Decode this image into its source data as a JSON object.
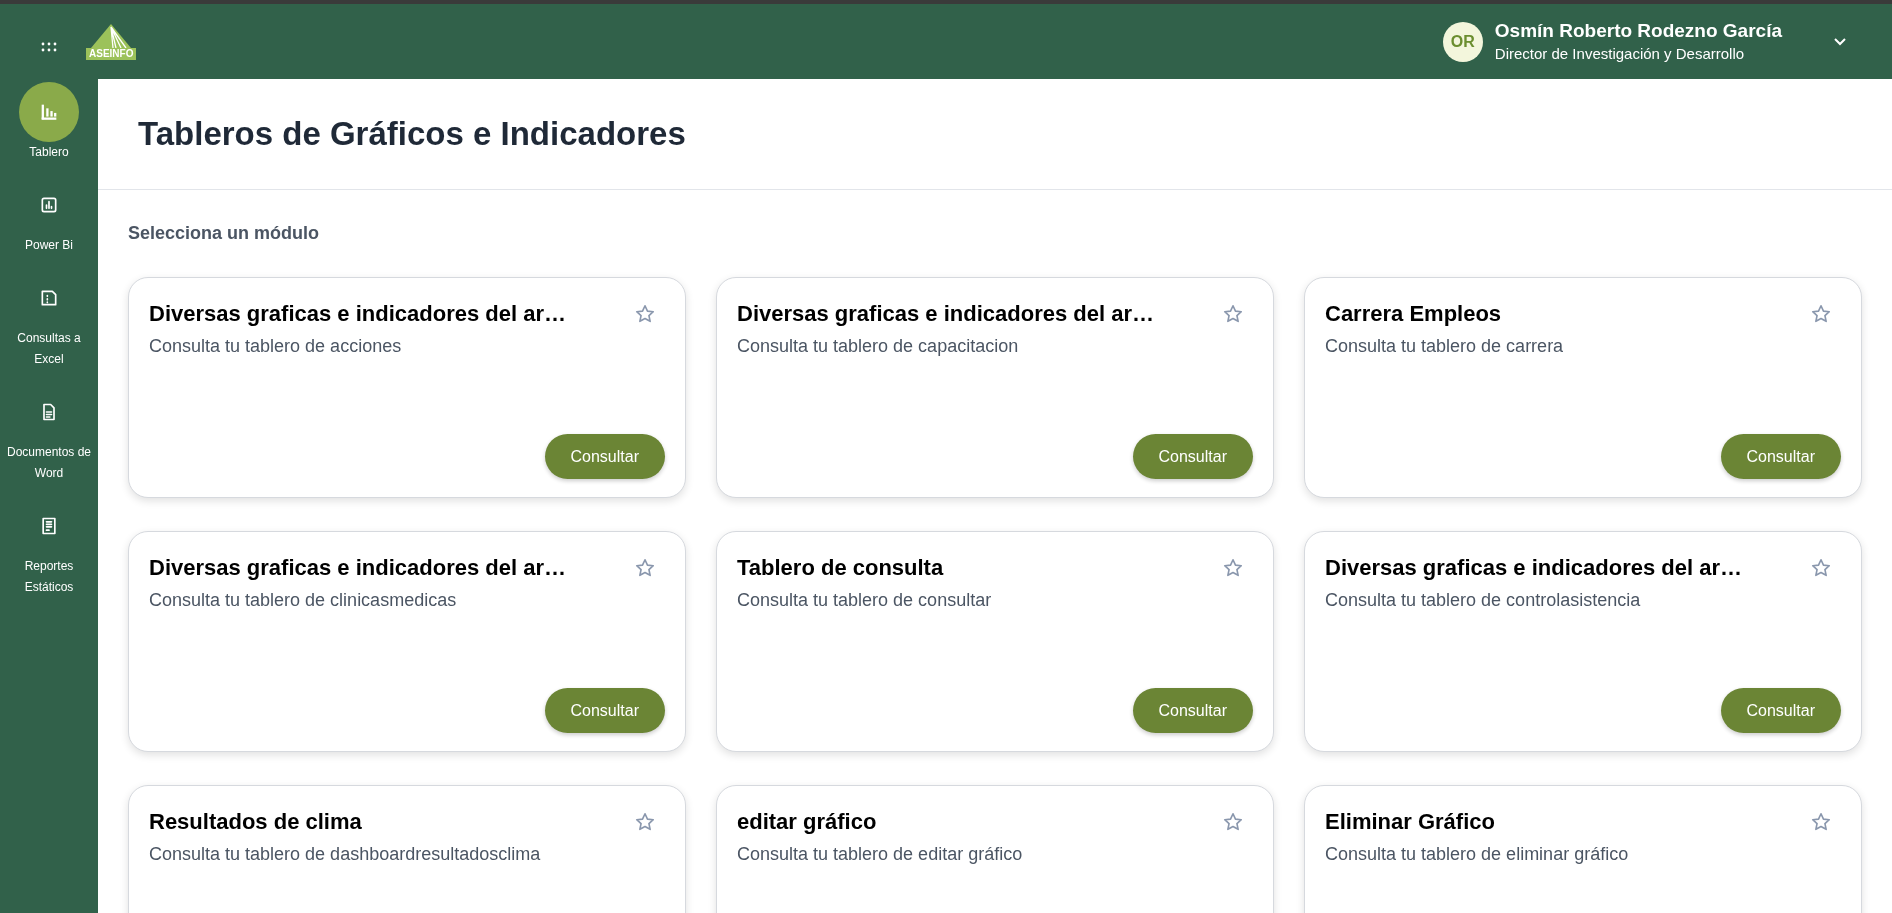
{
  "header": {
    "logo_text": "ASEINFO",
    "user": {
      "initials": "OR",
      "name": "Osmín Roberto Rodezno García",
      "role": "Director de Investigación y Desarrollo"
    }
  },
  "sidebar": {
    "items": [
      {
        "label": "Tablero",
        "kind": "chart",
        "selected": true
      },
      {
        "label": "Power Bi",
        "kind": "report",
        "selected": false
      },
      {
        "label": "Consultas a Excel",
        "kind": "sheet",
        "selected": false
      },
      {
        "label": "Documentos de Word",
        "kind": "doc",
        "selected": false
      },
      {
        "label": "Reportes Estáticos",
        "kind": "static",
        "selected": false
      }
    ]
  },
  "page_title": "Tableros de Gráficos e Indicadores",
  "section_label": "Selecciona un módulo",
  "cards": [
    {
      "title": "Diversas graficas e indicadores del ar…",
      "subtitle": "Consulta tu tablero de acciones",
      "favorite": false,
      "button": "Consultar"
    },
    {
      "title": "Diversas graficas e indicadores del ar…",
      "subtitle": "Consulta tu tablero de capacitacion",
      "favorite": false,
      "button": "Consultar"
    },
    {
      "title": "Carrera Empleos",
      "subtitle": "Consulta tu tablero de carrera",
      "favorite": false,
      "button": "Consultar"
    },
    {
      "title": "Diversas graficas e indicadores del ar…",
      "subtitle": "Consulta tu tablero de clinicasmedicas",
      "favorite": false,
      "button": "Consultar"
    },
    {
      "title": "Tablero de consulta",
      "subtitle": "Consulta tu tablero de consultar",
      "favorite": false,
      "button": "Consultar"
    },
    {
      "title": "Diversas graficas e indicadores del ar…",
      "subtitle": "Consulta tu tablero de controlasistencia",
      "favorite": false,
      "button": "Consultar"
    },
    {
      "title": "Resultados de clima",
      "subtitle": "Consulta tu tablero de dashboardresultadosclima",
      "favorite": false
    },
    {
      "title": "editar gráfico",
      "subtitle": "Consulta tu tablero de editar gráfico",
      "favorite": false
    },
    {
      "title": "Eliminar Gráfico",
      "subtitle": "Consulta tu tablero de eliminar gráfico",
      "favorite": false
    }
  ]
}
